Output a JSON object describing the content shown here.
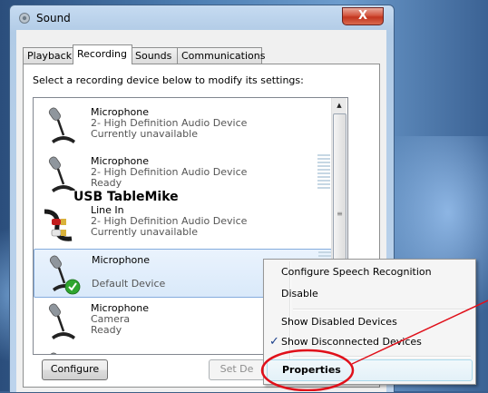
{
  "window": {
    "title": "Sound",
    "close_glyph": "X"
  },
  "tabs": [
    {
      "label": "Playback"
    },
    {
      "label": "Recording"
    },
    {
      "label": "Sounds"
    },
    {
      "label": "Communications"
    }
  ],
  "instruction": "Select a recording device below to modify its settings:",
  "devices": [
    {
      "name": "Microphone",
      "description": "2- High Definition Audio Device",
      "status": "Currently unavailable",
      "icon": "microphone-icon"
    },
    {
      "name": "Microphone",
      "description": "2- High Definition Audio Device",
      "status": "Ready",
      "icon": "microphone-icon"
    },
    {
      "name": "Line In",
      "description": "2- High Definition Audio Device",
      "status": "Currently unavailable",
      "icon": "line-in-cable-icon"
    },
    {
      "name": "Microphone",
      "description": "",
      "status": "Default Device",
      "icon": "microphone-default-icon"
    },
    {
      "name": "Microphone",
      "description": "Camera",
      "status": "Ready",
      "icon": "microphone-icon"
    }
  ],
  "overlay_label": "USB TableMike",
  "buttons": {
    "configure": "Configure",
    "set_default": "Set De"
  },
  "context_menu": {
    "items": [
      {
        "label": "Configure Speech Recognition",
        "checked": false
      },
      {
        "label": "Disable",
        "checked": false
      },
      {
        "label": "Show Disabled Devices",
        "checked": false
      },
      {
        "label": "Show Disconnected Devices",
        "checked": true
      },
      {
        "label": "Properties",
        "checked": false
      }
    ],
    "check_glyph": "✓"
  },
  "colors": {
    "selection": "#d9e9fa",
    "annotation": "#e0101a",
    "check": "#1b3f8b"
  }
}
